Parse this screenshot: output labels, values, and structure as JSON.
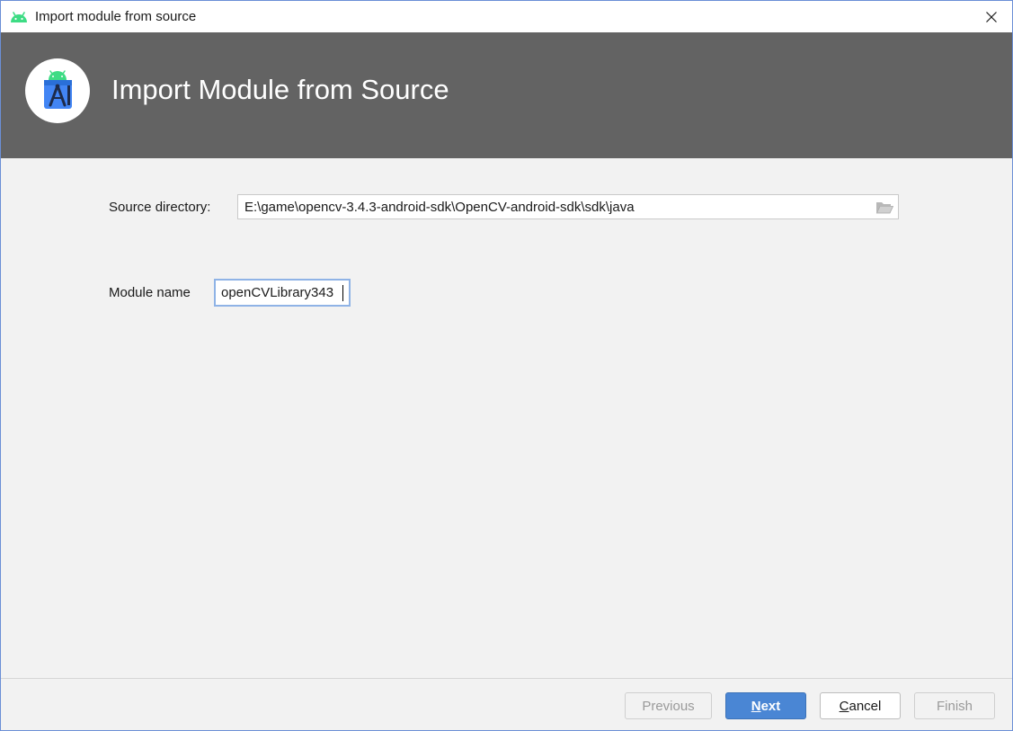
{
  "window": {
    "title": "Import module from source",
    "close_glyph": "✕"
  },
  "banner": {
    "heading": "Import Module from Source",
    "logo_icon": "android-studio-icon"
  },
  "form": {
    "source_directory": {
      "label": "Source directory:",
      "value": "E:\\game\\opencv-3.4.3-android-sdk\\OpenCV-android-sdk\\sdk\\java",
      "browse_icon": "folder-open-icon"
    },
    "module_name": {
      "label": "Module name",
      "value": "openCVLibrary343"
    }
  },
  "buttons": {
    "previous": "Previous",
    "next": {
      "mnemonic": "N",
      "rest": "ext"
    },
    "cancel": {
      "mnemonic": "C",
      "rest": "ancel"
    },
    "finish": "Finish"
  },
  "colors": {
    "banner": "#636363",
    "primary_button": "#4a86d4",
    "focus_border": "#8fb3e6",
    "android_green": "#3ddc84"
  }
}
